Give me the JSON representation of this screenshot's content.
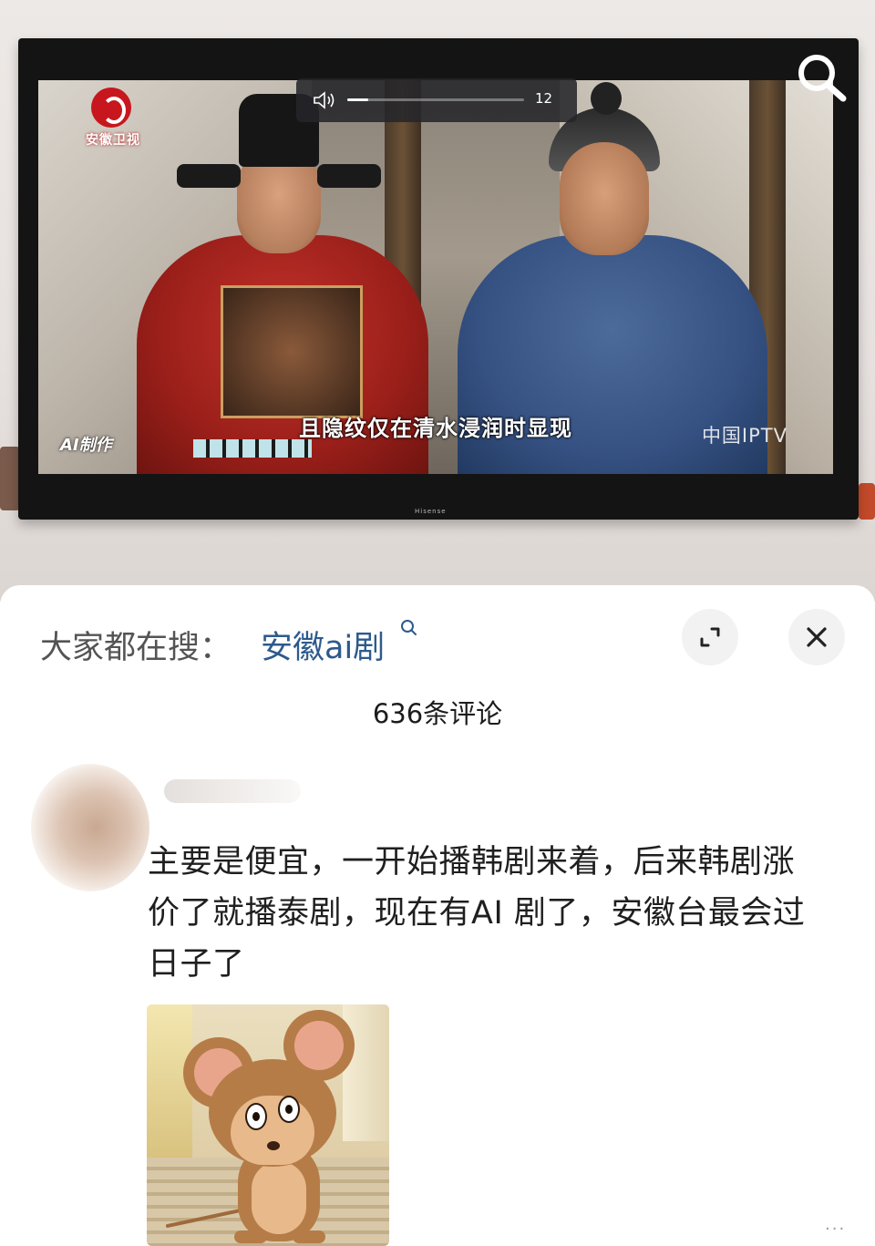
{
  "tv": {
    "station_name": "安徽卫视",
    "ai_mark": "AI制作",
    "subtitle": "且隐纹仅在清水浸润时显现",
    "watermark": "中国IPTV",
    "brand": "Hisense",
    "volume": {
      "value_label": "12",
      "level": 12,
      "max": 100
    }
  },
  "search_bar": {
    "label": "大家都在搜：",
    "term": "安徽ai剧"
  },
  "comments_header": {
    "count_label": "636条评论"
  },
  "comment": {
    "text": "主要是便宜，一开始播韩剧来着，后来韩剧涨价了就播泰剧，现在有AI 剧了，安徽台最会过日子了"
  },
  "icons": {
    "expand": "expand-icon",
    "close": "close-icon",
    "search": "search-icon",
    "volume": "speaker-icon",
    "more": "more-icon"
  },
  "colors": {
    "search_term": "#2d5a8c",
    "label": "#545454",
    "text": "#1f1f1f",
    "station_red": "#c8161e"
  }
}
